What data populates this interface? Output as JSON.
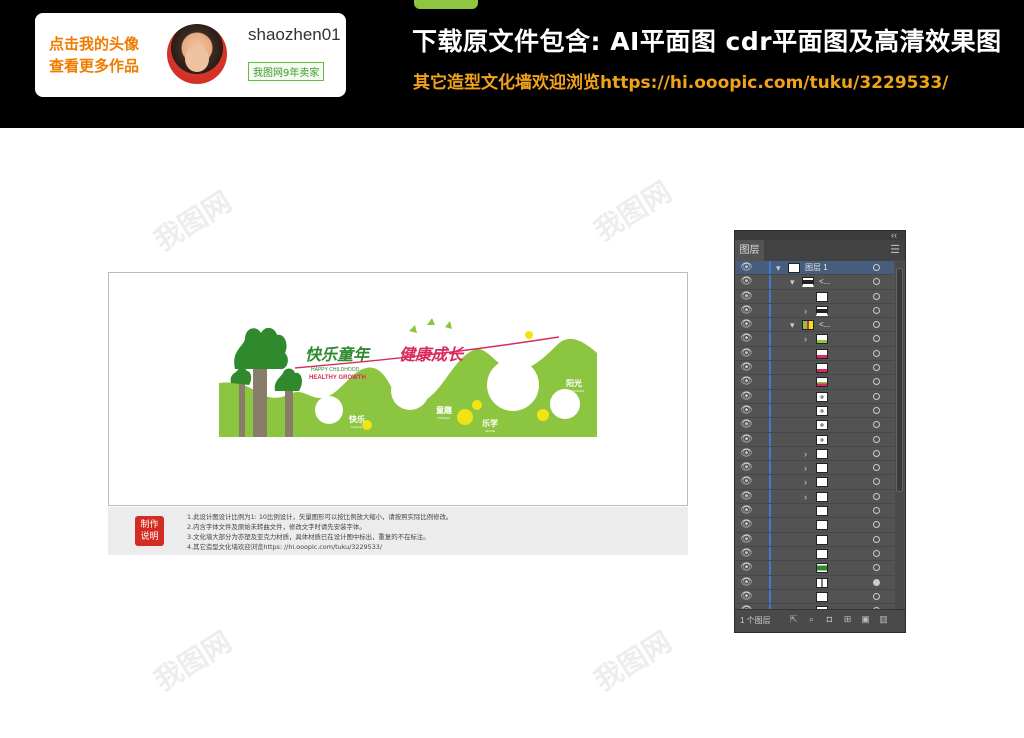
{
  "banner": {
    "author_cta": [
      "点击我的头像",
      "查看更多作品"
    ],
    "author_name": "shaozhen01",
    "author_badge": "我图网9年卖家",
    "headline": "下载原文件包含:  AI平面图  cdr平面图及高清效果图",
    "subline": "其它造型文化墙欢迎浏览https://hi.ooopic.com/tuku/3229533/"
  },
  "watermark": "我图网",
  "design": {
    "slogan_a": "快乐童年",
    "slogan_b": "健康成长",
    "sub_en_1": "HAPPY CHILDHOOD",
    "sub_en_2": "HEALTHY GROWTH",
    "words": [
      {
        "cn": "快乐",
        "en": "KUAILE"
      },
      {
        "cn": "童趣",
        "en": "TONGQU"
      },
      {
        "cn": "乐学",
        "en": "LEXUE"
      },
      {
        "cn": "阳光",
        "en": "YANGGUANG"
      }
    ],
    "colors": {
      "green": "#8cc540",
      "dark_green": "#2f8a2e",
      "trunk": "#8a7c6a",
      "yellow": "#f2e312",
      "red": "#d82a5c"
    }
  },
  "notes": {
    "stamp": [
      "制作",
      "说明"
    ],
    "lines": [
      "1.此设计图设计比例为1: 10比例设计，矢量图形可以按比例放大缩小，请按照实际比例修改。",
      "2.内含字体文件及原始未转曲文件，修改文字时请先安装字体。",
      "3.文化墙大部分为亦塑及亚克力材质，具体材质已在设计图中标出，重复的不在标注。",
      "4.其它造型文化墙欢迎浏览https: //hi.ooopic.com/tuku/3229533/"
    ]
  },
  "layers_panel": {
    "tab": "图层",
    "collapse": "‹‹",
    "menu_icon": "hamburger-icon",
    "layer_count": "1 个图层",
    "rows": [
      {
        "indent": 0,
        "disclose": "▾",
        "label": "图层 1",
        "selected": true,
        "thumb": "doc",
        "target": "empty"
      },
      {
        "indent": 1,
        "disclose": "▾",
        "label": "<...",
        "selected": false,
        "thumb": "dash",
        "target": "empty"
      },
      {
        "indent": 2,
        "disclose": "",
        "label": "",
        "selected": false,
        "thumb": "white",
        "target": "empty"
      },
      {
        "indent": 2,
        "disclose": "›",
        "label": "",
        "selected": false,
        "thumb": "dash",
        "target": "empty"
      },
      {
        "indent": 1,
        "disclose": "▾",
        "label": "<...",
        "selected": false,
        "thumb": "colors",
        "target": "empty"
      },
      {
        "indent": 2,
        "disclose": "›",
        "label": "",
        "selected": false,
        "thumb": "green",
        "target": "empty"
      },
      {
        "indent": 2,
        "disclose": "",
        "label": "",
        "selected": false,
        "thumb": "red",
        "target": "empty"
      },
      {
        "indent": 2,
        "disclose": "",
        "label": "",
        "selected": false,
        "thumb": "red",
        "target": "empty"
      },
      {
        "indent": 2,
        "disclose": "",
        "label": "",
        "selected": false,
        "thumb": "mixed",
        "target": "empty"
      },
      {
        "indent": 2,
        "disclose": "",
        "label": "",
        "selected": false,
        "thumb": "circle",
        "target": "empty"
      },
      {
        "indent": 2,
        "disclose": "",
        "label": "",
        "selected": false,
        "thumb": "circle",
        "target": "empty"
      },
      {
        "indent": 2,
        "disclose": "",
        "label": "",
        "selected": false,
        "thumb": "circle",
        "target": "empty"
      },
      {
        "indent": 2,
        "disclose": "",
        "label": "",
        "selected": false,
        "thumb": "circle",
        "target": "empty"
      },
      {
        "indent": 2,
        "disclose": "›",
        "label": "",
        "selected": false,
        "thumb": "white",
        "target": "empty"
      },
      {
        "indent": 2,
        "disclose": "›",
        "label": "",
        "selected": false,
        "thumb": "white",
        "target": "empty"
      },
      {
        "indent": 2,
        "disclose": "›",
        "label": "",
        "selected": false,
        "thumb": "white",
        "target": "empty"
      },
      {
        "indent": 2,
        "disclose": "›",
        "label": "",
        "selected": false,
        "thumb": "white",
        "target": "empty"
      },
      {
        "indent": 2,
        "disclose": "",
        "label": "",
        "selected": false,
        "thumb": "white",
        "target": "empty"
      },
      {
        "indent": 2,
        "disclose": "",
        "label": "",
        "selected": false,
        "thumb": "white",
        "target": "empty"
      },
      {
        "indent": 2,
        "disclose": "",
        "label": "",
        "selected": false,
        "thumb": "white",
        "target": "empty"
      },
      {
        "indent": 2,
        "disclose": "",
        "label": "",
        "selected": false,
        "thumb": "white",
        "target": "empty"
      },
      {
        "indent": 2,
        "disclose": "",
        "label": "",
        "selected": false,
        "thumb": "tree",
        "target": "empty"
      },
      {
        "indent": 2,
        "disclose": "",
        "label": "",
        "selected": false,
        "thumb": "trunk",
        "target": "filled"
      },
      {
        "indent": 2,
        "disclose": "",
        "label": "",
        "selected": false,
        "thumb": "white",
        "target": "empty"
      },
      {
        "indent": 2,
        "disclose": "",
        "label": "",
        "selected": false,
        "thumb": "white",
        "target": "empty"
      }
    ],
    "footer_icons": [
      "export-icon",
      "search-icon",
      "clip-mask-icon",
      "new-sublayer-icon",
      "new-layer-icon",
      "trash-icon"
    ]
  }
}
